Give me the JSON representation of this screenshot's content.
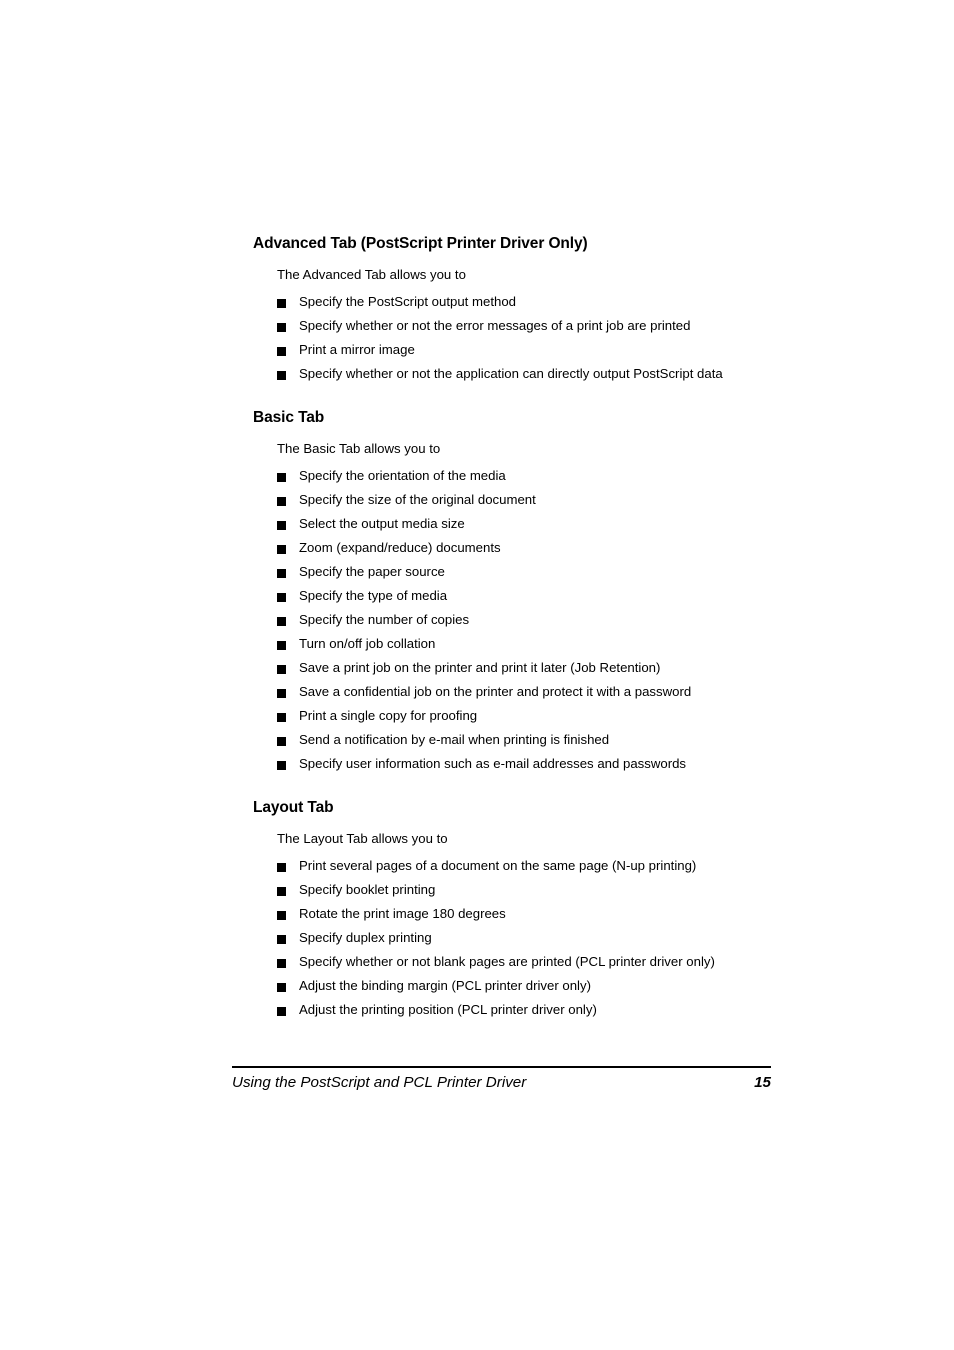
{
  "page": {
    "background_color": "#ffffff",
    "text_color": "#000000",
    "bullet_marker": "filled-square"
  },
  "sections": [
    {
      "heading": "Advanced Tab (PostScript Printer Driver Only)",
      "intro": "The Advanced Tab allows you to",
      "items": [
        "Specify the PostScript output method",
        "Specify whether or not the error messages of a print job are printed",
        "Print a mirror image",
        "Specify whether or not the application can directly output PostScript data"
      ]
    },
    {
      "heading": "Basic Tab",
      "intro": "The Basic Tab allows you to",
      "items": [
        "Specify the orientation of the media",
        "Specify the size of the original document",
        "Select the output media size",
        "Zoom (expand/reduce) documents",
        "Specify the paper source",
        "Specify the type of media",
        "Specify the number of copies",
        "Turn on/off job collation",
        "Save a print job on the printer and print it later (Job Retention)",
        "Save a confidential job on the printer and protect it with a password",
        "Print a single copy for proofing",
        "Send a notification by e-mail when printing is finished",
        "Specify user information such as e-mail addresses and passwords"
      ]
    },
    {
      "heading": "Layout Tab",
      "intro": "The Layout Tab allows you to",
      "items": [
        "Print several pages of a document on the same page (N-up printing)",
        "Specify booklet printing",
        "Rotate the print image 180 degrees",
        "Specify duplex printing",
        "Specify whether or not blank pages are printed (PCL printer driver only)",
        "Adjust the binding margin (PCL printer driver only)",
        "Adjust the printing position (PCL printer driver only)"
      ]
    }
  ],
  "footer": {
    "title": "Using the PostScript and PCL Printer Driver",
    "page_number": "15"
  }
}
